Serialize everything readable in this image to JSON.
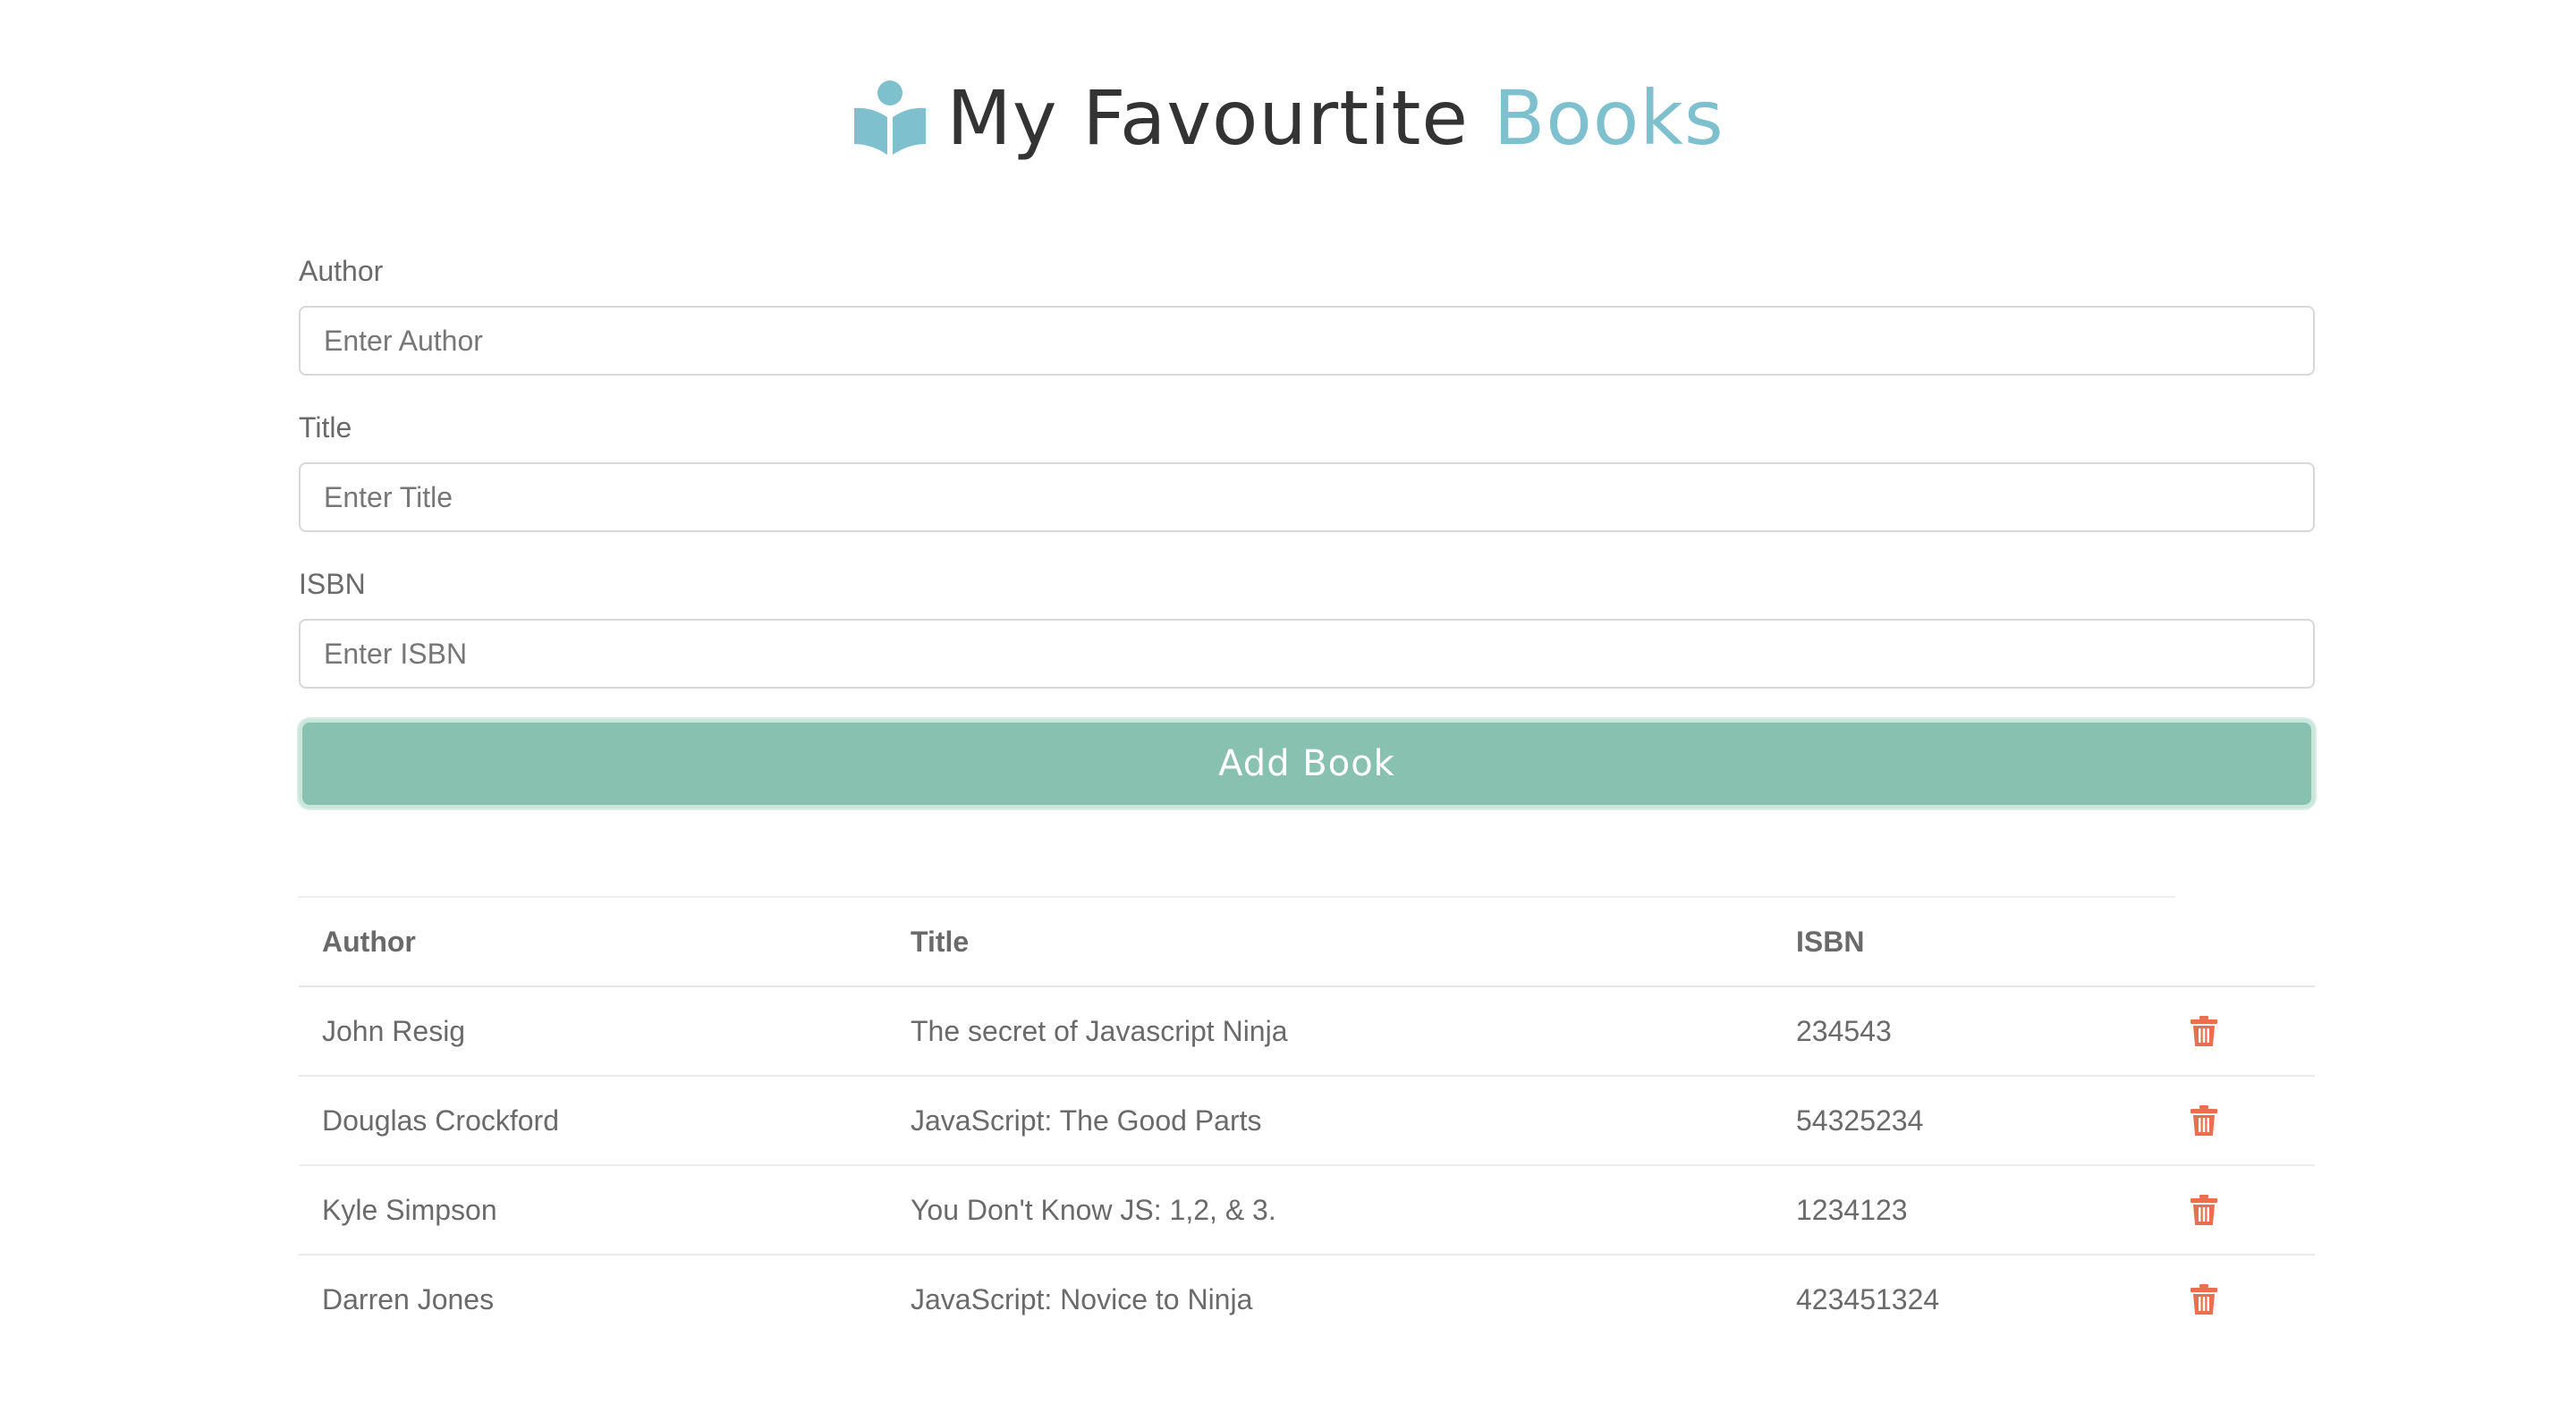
{
  "header": {
    "title_main": "My Favourtite",
    "title_accent": "Books",
    "icon": "book-reader-icon"
  },
  "form": {
    "author": {
      "label": "Author",
      "placeholder": "Enter Author",
      "value": ""
    },
    "title": {
      "label": "Title",
      "placeholder": "Enter Title",
      "value": ""
    },
    "isbn": {
      "label": "ISBN",
      "placeholder": "Enter ISBN",
      "value": ""
    },
    "submit_label": "Add Book"
  },
  "table": {
    "headers": {
      "author": "Author",
      "title": "Title",
      "isbn": "ISBN"
    },
    "rows": [
      {
        "author": "John Resig",
        "title": "The secret of Javascript Ninja",
        "isbn": "234543",
        "action_icon": "trash-icon"
      },
      {
        "author": "Douglas Crockford",
        "title": "JavaScript: The Good Parts",
        "isbn": "54325234",
        "action_icon": "trash-icon"
      },
      {
        "author": "Kyle Simpson",
        "title": "You Don't Know JS: 1,2, & 3.",
        "isbn": "1234123",
        "action_icon": "trash-icon"
      },
      {
        "author": "Darren Jones",
        "title": "JavaScript: Novice to Ninja",
        "isbn": "423451324",
        "action_icon": "trash-icon"
      }
    ]
  },
  "colors": {
    "accent": "#7fc0cf",
    "button": "#89c1b0",
    "delete": "#e8704f",
    "text": "#6a6a6a",
    "heading": "#333333"
  }
}
